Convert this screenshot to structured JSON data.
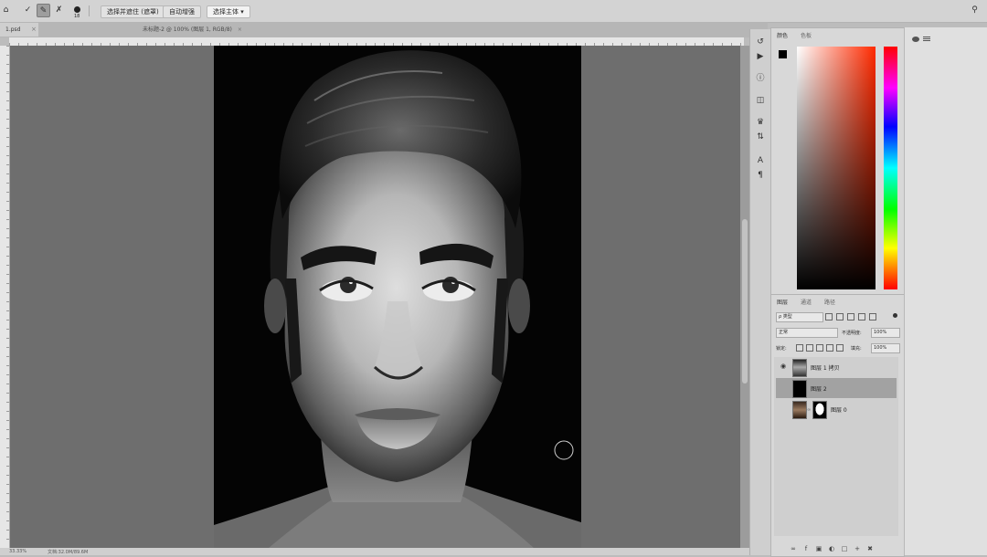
{
  "options_bar": {
    "brush_size": "18",
    "buttons": [
      {
        "label": "选择并遮住 (遮罩)"
      },
      {
        "label": "自动增强"
      },
      {
        "label": "选择主体 ▾"
      }
    ]
  },
  "doc_tabs": [
    {
      "label": "1.psd",
      "active": true
    },
    {
      "label": "未标题-2 @ 100% (图层 1, RGB/8)",
      "active": false
    }
  ],
  "status_bar": {
    "zoom": "33.33%",
    "doc_info": "文档:32.0M/89.6M"
  },
  "color_panel": {
    "tabs": [
      "颜色",
      "色板"
    ],
    "foreground": "#000000",
    "background": "#ffffff",
    "hue_accent": "#ff2a00"
  },
  "layers_panel": {
    "tabs": [
      "图层",
      "通道",
      "路径"
    ],
    "filter_kind": "ρ 类型",
    "blend_mode": "正常",
    "opacity_label": "不透明度:",
    "opacity_value": "100%",
    "lock_label": "锁定:",
    "fill_label": "填充:",
    "fill_value": "100%",
    "layers": [
      {
        "name": "图层 1 拷贝",
        "visible": true,
        "selected": false,
        "thumb": "portrait-bw"
      },
      {
        "name": "图层 2",
        "visible": false,
        "selected": true,
        "thumb": "solid-black"
      },
      {
        "name": "图层 0",
        "visible": false,
        "selected": false,
        "thumb": "portrait-color",
        "has_mask": true
      }
    ]
  },
  "icons": {
    "strip": [
      "history-icon",
      "play-icon",
      "info-icon",
      "clone-source-icon",
      "brush-preset-icon",
      "adjust-icon",
      "character-icon",
      "paragraph-icon"
    ],
    "footer": [
      "link-icon",
      "fx-icon",
      "mask-icon",
      "adjustment-icon",
      "group-icon",
      "new-layer-icon",
      "trash-icon"
    ]
  }
}
